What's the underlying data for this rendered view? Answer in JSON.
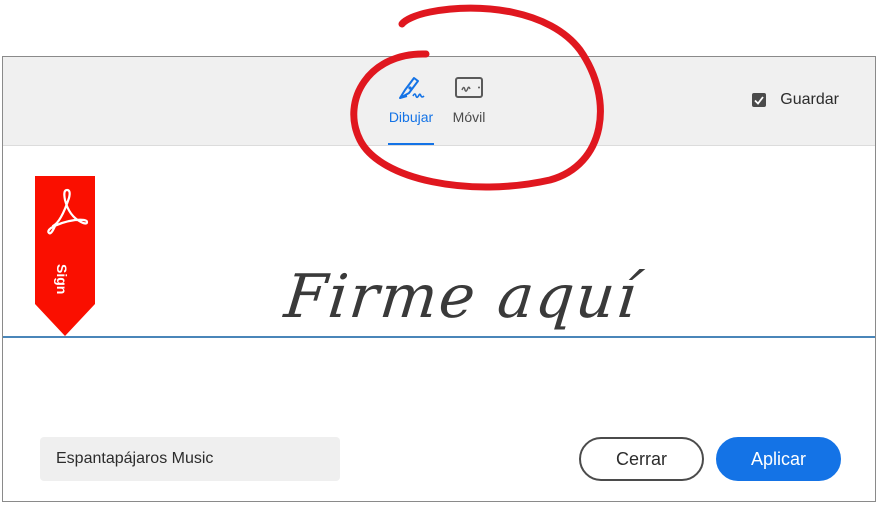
{
  "tabs": [
    {
      "label": "Dibujar",
      "icon": "pen-draw-icon",
      "active": true
    },
    {
      "label": "Móvil",
      "icon": "tablet-signature-icon",
      "active": false
    }
  ],
  "save": {
    "label": "Guardar",
    "checked": true
  },
  "signature": {
    "placeholder": "Firme aquí"
  },
  "ribbon": {
    "label": "Sign",
    "icon": "adobe-acrobat-logo",
    "color": "#fa0f00"
  },
  "name_field": {
    "value": "Espantapájaros Music"
  },
  "buttons": {
    "close": "Cerrar",
    "apply": "Aplicar"
  },
  "colors": {
    "accent": "#1473e6",
    "annotation": "#e0171f"
  }
}
